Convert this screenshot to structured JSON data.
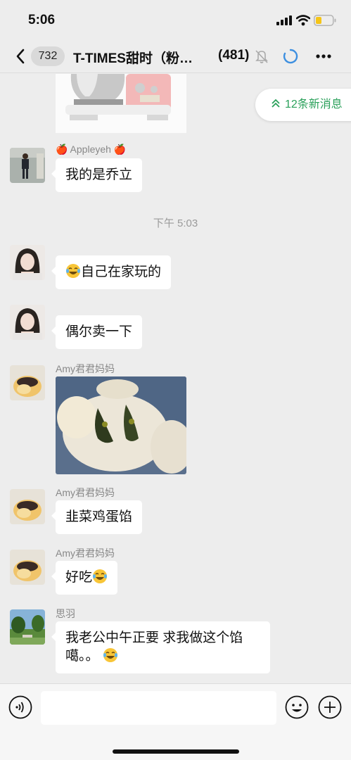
{
  "status_bar": {
    "time": "5:06",
    "icons": [
      "signal-icon",
      "wifi-icon",
      "battery-icon"
    ]
  },
  "nav": {
    "back_icon": "back-chevron-icon",
    "unread_count": "732",
    "title": "T-TIMES甜时（粉…",
    "member_count": "(481)",
    "icons": [
      "mute-bell-icon",
      "loading-icon",
      "more-icon"
    ]
  },
  "new_messages": {
    "label": "12条新消息",
    "icon": "double-chevron-up-icon"
  },
  "messages": [
    {
      "type": "image",
      "description_icon": "stand-mixer-photo"
    },
    {
      "sender": "🍎 Appleyeh 🍎",
      "text": "我的是乔立"
    },
    {
      "type": "time",
      "text": "下午 5:03"
    },
    {
      "text": "自己在家玩的",
      "emoji": "tears-of-joy-emoji"
    },
    {
      "text": "偶尔卖一下"
    },
    {
      "sender": "Amy君君妈妈",
      "type": "image",
      "description_icon": "steamed-bun-photo"
    },
    {
      "sender": "Amy君君妈妈",
      "text": "韭菜鸡蛋馅"
    },
    {
      "sender": "Amy君君妈妈",
      "text": "好吃",
      "emoji": "tears-of-joy-emoji"
    },
    {
      "sender": "思羽",
      "text_line1": "我老公中午正要 求我做这个馅",
      "text_line2": "噶。。",
      "emoji": "tears-of-joy-emoji"
    }
  ],
  "input_bar": {
    "icons": [
      "voice-icon",
      "emoji-icon",
      "plus-icon"
    ],
    "placeholder": ""
  },
  "colors": {
    "background": "#ededed",
    "bubble": "#ffffff",
    "accent_green": "#2aa05a",
    "battery": "#f5c518"
  }
}
